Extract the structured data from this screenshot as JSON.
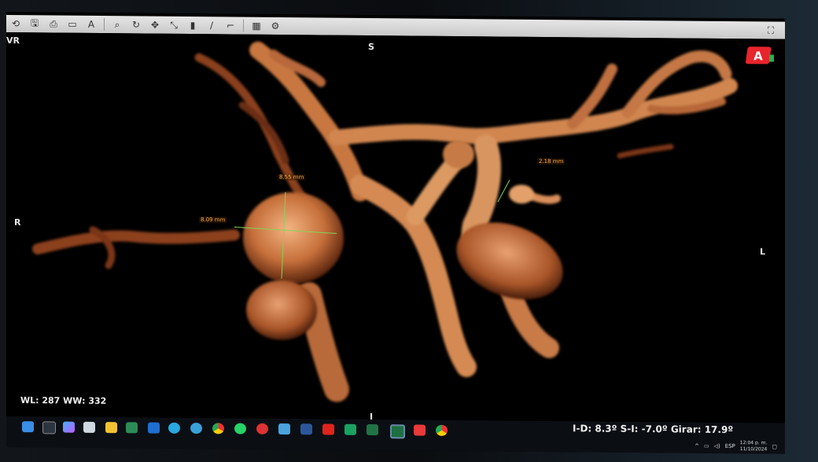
{
  "viewer": {
    "view_mode": "VR",
    "orientation": {
      "top": "S",
      "bottom": "I",
      "left": "R",
      "right": "L"
    },
    "measurements": [
      {
        "label": "8.55 mm"
      },
      {
        "label": "8.09 mm"
      },
      {
        "label": "2.18 mm"
      }
    ],
    "window_level": "WL: 287 WW: 332",
    "rotation": "I-D: 8.3º S-I: -7.0º Girar: 17.9º",
    "logo_letter": "A"
  },
  "colors": {
    "vessel": "#c4703a",
    "vessel_highlight": "#f0b07a",
    "measure_line": "#7fd65a",
    "label": "#ffb347",
    "logo_red": "#e8242c"
  },
  "toolbar": {
    "icons": [
      "rotate-icon",
      "save-icon",
      "print-icon",
      "layout-icon",
      "text-icon",
      "zoom-icon",
      "reset-icon",
      "pan-icon",
      "measure-icon",
      "window-level-icon",
      "line-icon",
      "crop-icon",
      "grid-icon",
      "settings-icon"
    ],
    "right_icons": [
      "fullscreen-icon"
    ]
  },
  "taskbar": {
    "apps": [
      "start-icon",
      "search-icon",
      "copilot-icon",
      "edge-icon",
      "file-explorer-icon",
      "photos-icon",
      "store-icon",
      "chrome-icon",
      "telegram-icon",
      "chrome-alt-icon",
      "whatsapp-icon",
      "viewer-icon",
      "camera-icon",
      "word-icon",
      "acrobat-icon",
      "meet-icon",
      "excel-icon",
      "dicom-icon",
      "record-icon",
      "chrome-canary-icon"
    ],
    "tray_language": "ESP",
    "clock_time": "12:04 p. m.",
    "clock_date": "11/10/2024"
  }
}
